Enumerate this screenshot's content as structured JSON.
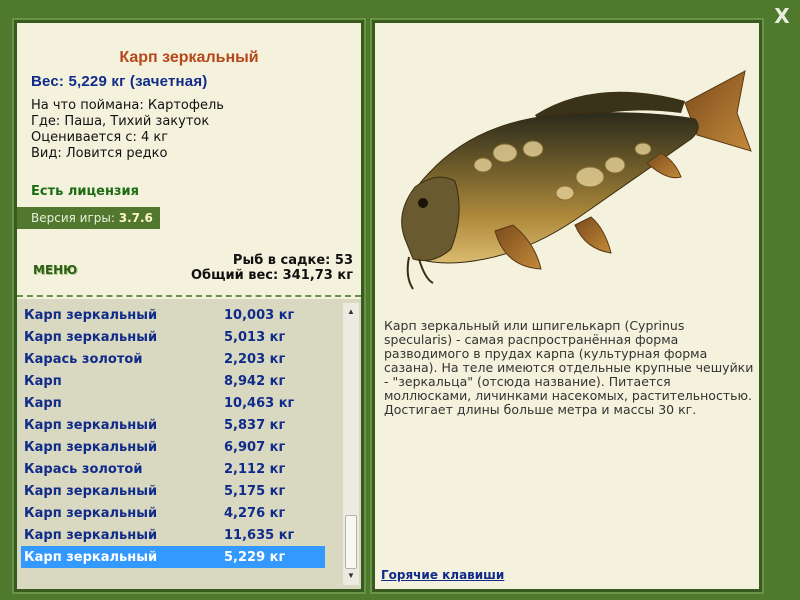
{
  "close_label": "X",
  "fish_card": {
    "title": "Карп зеркальный",
    "weight": "Вес: 5,229 кг (зачетная)",
    "info": [
      "На что поймана: Картофель",
      "Где: Паша, Тихий закуток",
      "Оценивается с: 4 кг",
      "Вид: Ловится редко"
    ]
  },
  "license": "Есть лицензия",
  "version": {
    "label": "Версия игры:",
    "value": "3.7.6"
  },
  "menu_label": "МЕНЮ",
  "summary": {
    "fish_in_keepnet": "Рыб в садке: 53",
    "total_weight": "Общий вес: 341,73 кг"
  },
  "catch_list": [
    {
      "name": "Карп зеркальный",
      "weight": "10,003 кг"
    },
    {
      "name": "Карп зеркальный",
      "weight": "5,013 кг"
    },
    {
      "name": "Карась золотой",
      "weight": "2,203 кг"
    },
    {
      "name": "Карп",
      "weight": "8,942 кг"
    },
    {
      "name": "Карп",
      "weight": "10,463 кг"
    },
    {
      "name": "Карп зеркальный",
      "weight": "5,837 кг"
    },
    {
      "name": "Карп зеркальный",
      "weight": "6,907 кг"
    },
    {
      "name": "Карась золотой",
      "weight": "2,112 кг"
    },
    {
      "name": "Карп зеркальный",
      "weight": "5,175 кг"
    },
    {
      "name": "Карп зеркальный",
      "weight": "4,276 кг"
    },
    {
      "name": "Карп зеркальный",
      "weight": "11,635 кг"
    },
    {
      "name": "Карп зеркальный",
      "weight": "5,229 кг",
      "selected": true
    }
  ],
  "description": "Карп зеркальный или шпигелькарп (Cyprinus specularis) - самая распространённая форма разводимого в прудах карпа (культурная форма сазана). На теле имеются отдельные крупные чешуйки - \"зеркальца\" (отсюда название). Питается моллюсками, личинками насекомых, растительностью. Достигает длины больше метра и массы 30 кг.",
  "hotkeys_label": "Горячие клавиши",
  "colors": {
    "background": "#4f7a2e",
    "panel": "#f4f2dc",
    "title": "#b5471a",
    "link": "#102b8a",
    "selection": "#3399ff"
  },
  "icons": {
    "close": "close-icon",
    "scroll_up": "arrow-up-icon",
    "scroll_down": "arrow-down-icon"
  }
}
